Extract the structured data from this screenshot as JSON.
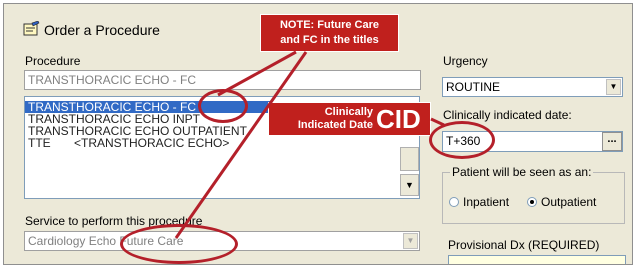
{
  "window": {
    "title": "Order a Procedure"
  },
  "procedure": {
    "label": "Procedure",
    "value": "TRANSTHORACIC ECHO - FC",
    "list": [
      "TRANSTHORACIC ECHO - FC",
      "TRANSTHORACIC ECHO INPT",
      "TRANSTHORACIC ECHO OUTPATIENT",
      "TTE       <TRANSTHORACIC ECHO>"
    ]
  },
  "service": {
    "label": "Service to perform this procedure",
    "value": "Cardiology Echo Future Care"
  },
  "urgency": {
    "label": "Urgency",
    "value": "ROUTINE"
  },
  "cid": {
    "label": "Clinically indicated date:",
    "value": "T+360",
    "button": "..."
  },
  "patient_seen": {
    "label": "Patient will be seen as an:",
    "inpatient": "Inpatient",
    "outpatient": "Outpatient",
    "selected": "Outpatient"
  },
  "provisional": {
    "label": "Provisional Dx (REQUIRED)"
  },
  "annotations": {
    "note_line1": "NOTE: Future Care",
    "note_line2": "and FC in the titles",
    "cid_small_1": "Clinically",
    "cid_small_2": "Indicated Date",
    "cid_big": "CID"
  },
  "colors": {
    "callout": "#c0201d",
    "selection": "#316ac5",
    "dialog": "#ece9d8"
  }
}
